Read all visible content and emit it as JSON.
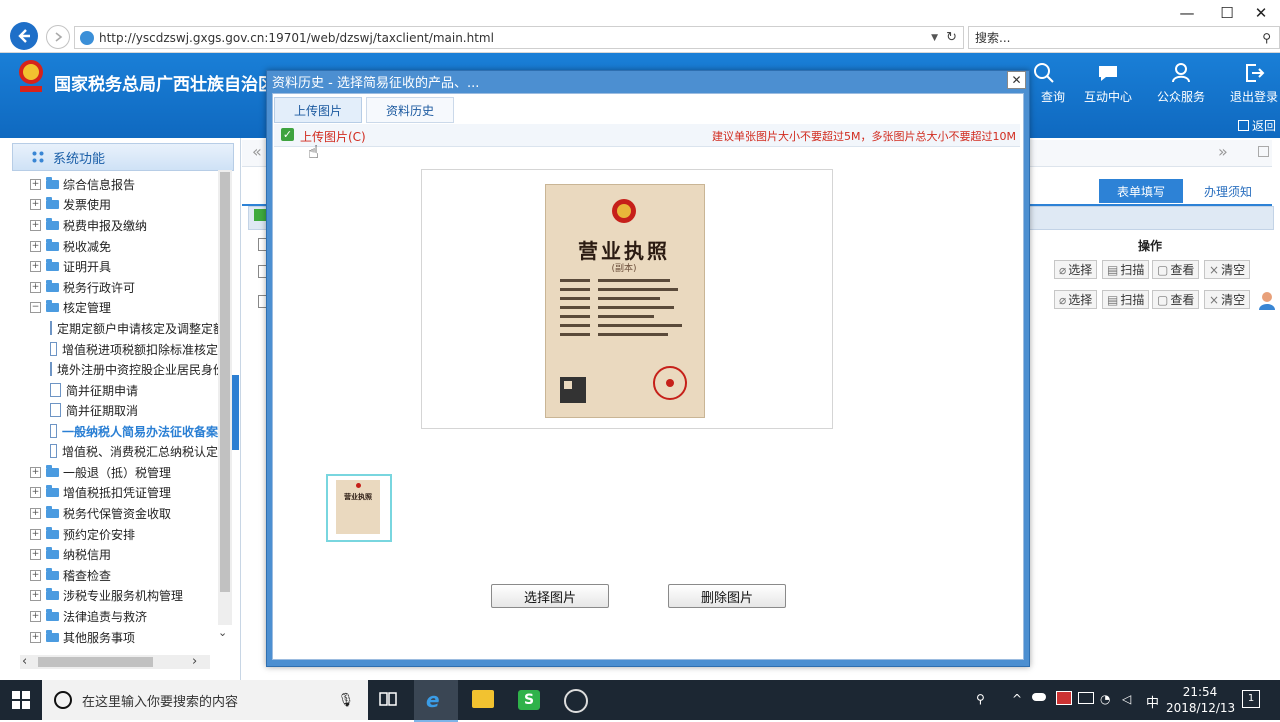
{
  "browser": {
    "url": "http://yscdzswj.gxgs.gov.cn:19701/web/dzswj/taxclient/main.html",
    "search_placeholder": "搜索...",
    "minimize": "—",
    "maximize": "☐",
    "close": "✕"
  },
  "header": {
    "site_title": "国家税务总局广西壮族自治区",
    "nav": [
      {
        "label": "查询"
      },
      {
        "label": "互动中心"
      },
      {
        "label": "公众服务"
      },
      {
        "label": "退出登录"
      }
    ],
    "back_label": "返回"
  },
  "sidebar": {
    "title": "系统功能",
    "items": [
      {
        "label": "综合信息报告"
      },
      {
        "label": "发票使用"
      },
      {
        "label": "税费申报及缴纳"
      },
      {
        "label": "税收减免"
      },
      {
        "label": "证明开具"
      },
      {
        "label": "税务行政许可"
      },
      {
        "label": "核定管理"
      },
      {
        "label": "定期定额户申请核定及调整定额"
      },
      {
        "label": "增值税进项税额扣除标准核定"
      },
      {
        "label": "境外注册中资控股企业居民身份"
      },
      {
        "label": "简并征期申请"
      },
      {
        "label": "简并征期取消"
      },
      {
        "label": "一般纳税人简易办法征收备案"
      },
      {
        "label": "增值税、消费税汇总纳税认定"
      },
      {
        "label": "一般退（抵）税管理"
      },
      {
        "label": "增值税抵扣凭证管理"
      },
      {
        "label": "税务代保管资金收取"
      },
      {
        "label": "预约定价安排"
      },
      {
        "label": "纳税信用"
      },
      {
        "label": "稽查检查"
      },
      {
        "label": "涉税专业服务机构管理"
      },
      {
        "label": "法律追责与救济"
      },
      {
        "label": "其他服务事项"
      }
    ]
  },
  "content": {
    "tab_fill": "表单填写",
    "tab_guide": "办理须知",
    "op_header": "操作",
    "op_buttons": [
      "选择",
      "扫描",
      "查看",
      "清空"
    ]
  },
  "modal": {
    "title": "资料历史 - 选择简易征收的产品、...",
    "tabs": [
      "上传图片",
      "资料历史"
    ],
    "upload_label": "上传图片(C)",
    "size_hint": "建议单张图片大小不要超过5M，多张图片总大小不要超过10M",
    "license_title": "营业执照",
    "license_sub": "(副本)",
    "thumb_title": "营业执照",
    "select_button": "选择图片",
    "delete_button": "删除图片"
  },
  "taskbar": {
    "search_placeholder": "在这里输入你要搜索的内容",
    "time": "21:54",
    "date": "2018/12/13",
    "ime": "中",
    "notif_count": "1"
  }
}
